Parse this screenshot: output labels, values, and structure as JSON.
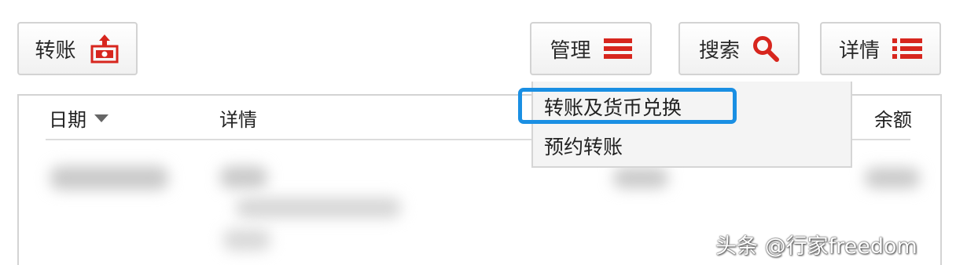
{
  "toolbar": {
    "transfer_label": "转账",
    "manage_label": "管理",
    "search_label": "搜索",
    "details_label": "详情"
  },
  "table": {
    "columns": {
      "date": "日期",
      "details": "详情",
      "balance": "余额"
    }
  },
  "dropdown": {
    "items": [
      "转账及货币兑换",
      "预约转账"
    ],
    "highlighted_index": 0
  },
  "watermark": "头条 @行家freedom",
  "colors": {
    "accent_red": "#d7261e",
    "highlight_blue": "#1a8fe3"
  },
  "icons": {
    "transfer": "cash-transfer-icon",
    "manage": "hamburger-menu-icon",
    "search": "magnifier-icon",
    "details": "list-icon",
    "sort": "caret-down-icon"
  }
}
